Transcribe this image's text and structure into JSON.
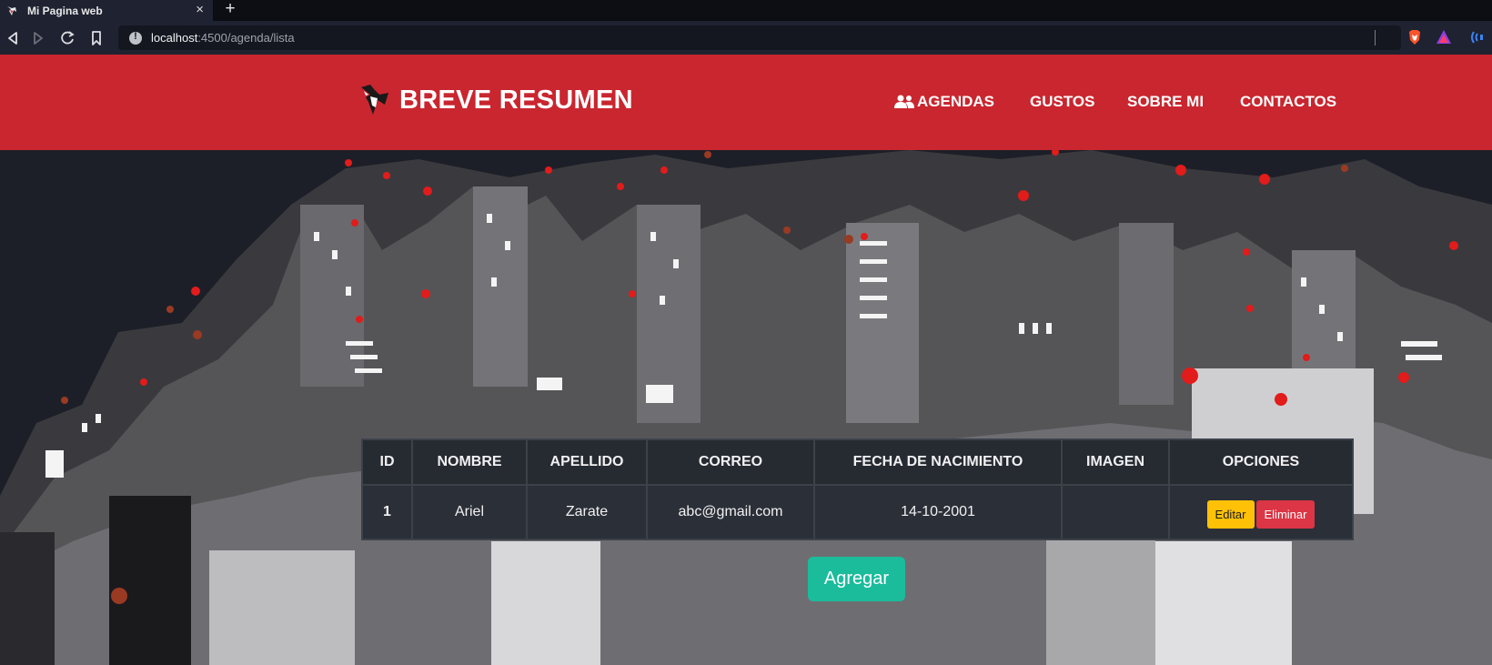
{
  "browser": {
    "tab_title": "Mi Pagina web",
    "tab_close": "×",
    "new_tab": "+",
    "url_host": "localhost",
    "url_path": ":4500/agenda/lista"
  },
  "header": {
    "brand": "BREVE RESUMEN",
    "nav": [
      "AGENDAS",
      "GUSTOS",
      "SOBRE MI",
      "CONTACTOS"
    ]
  },
  "table": {
    "columns": [
      "ID",
      "NOMBRE",
      "APELLIDO",
      "CORREO",
      "FECHA DE NACIMIENTO",
      "IMAGEN",
      "OPCIONES"
    ],
    "rows": [
      {
        "id": "1",
        "nombre": "Ariel",
        "apellido": "Zarate",
        "correo": "abc@gmail.com",
        "fecha": "14-10-2001",
        "imagen": ""
      }
    ],
    "edit_label": "Editar",
    "delete_label": "Eliminar"
  },
  "add_button": "Agregar",
  "colors": {
    "header": "#c9262f",
    "edit": "#ffc107",
    "delete": "#dc3545",
    "add": "#1abc9c"
  }
}
